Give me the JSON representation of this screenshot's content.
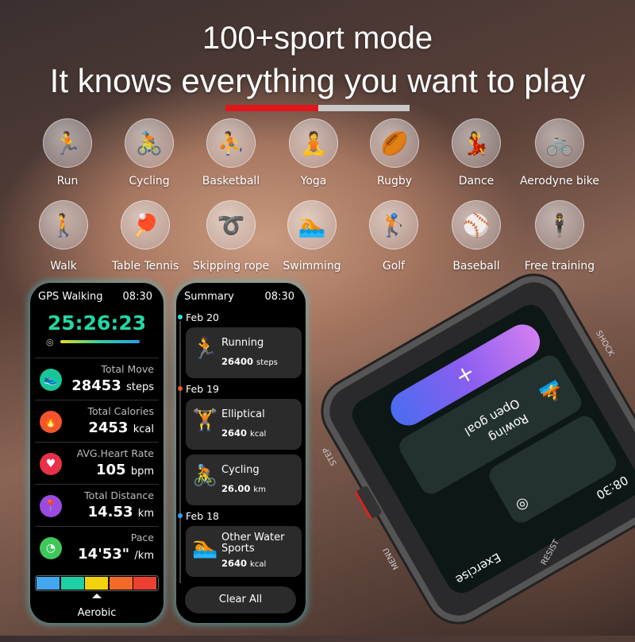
{
  "headline": {
    "line1": "100+sport mode",
    "line2": "It knows everything you want to play",
    "accent": "#e0161b"
  },
  "sports": [
    {
      "label": "Run",
      "icon": "run-icon",
      "glyph": "🏃"
    },
    {
      "label": "Cycling",
      "icon": "cycling-icon",
      "glyph": "🚴"
    },
    {
      "label": "Basketball",
      "icon": "basketball-icon",
      "glyph": "⛹"
    },
    {
      "label": "Yoga",
      "icon": "yoga-icon",
      "glyph": "🧘"
    },
    {
      "label": "Rugby",
      "icon": "rugby-icon",
      "glyph": "🏉"
    },
    {
      "label": "Dance",
      "icon": "dance-icon",
      "glyph": "💃"
    },
    {
      "label": "Aerodyne bike",
      "icon": "exercise-bike-icon",
      "glyph": "🚲"
    },
    {
      "label": "Walk",
      "icon": "walk-icon",
      "glyph": "🚶"
    },
    {
      "label": "Table Tennis",
      "icon": "table-tennis-icon",
      "glyph": "🏓"
    },
    {
      "label": "Skipping rope",
      "icon": "skipping-rope-icon",
      "glyph": "➰"
    },
    {
      "label": "Swimming",
      "icon": "swimming-icon",
      "glyph": "🏊"
    },
    {
      "label": "Golf",
      "icon": "golf-icon",
      "glyph": "🏌"
    },
    {
      "label": "Baseball",
      "icon": "baseball-icon",
      "glyph": "⚾"
    },
    {
      "label": "Free training",
      "icon": "free-training-icon",
      "glyph": "🕴"
    }
  ],
  "workout": {
    "title": "GPS Walking",
    "time": "08:30",
    "elapsed": "25:26:23",
    "zone": "Aerobic",
    "stats": [
      {
        "label": "Total Move",
        "value": "28453",
        "unit": "steps",
        "icon": "shoe-icon",
        "glyph": "👟",
        "color": "#17c79a"
      },
      {
        "label": "Total Calories",
        "value": "2453",
        "unit": "kcal",
        "icon": "flame-icon",
        "glyph": "🔥",
        "color": "#f2542d"
      },
      {
        "label": "AVG.Heart Rate",
        "value": "105",
        "unit": "bpm",
        "icon": "heart-icon",
        "glyph": "♥",
        "color": "#e8304a"
      },
      {
        "label": "Total Distance",
        "value": "14.53",
        "unit": "km",
        "icon": "location-icon",
        "glyph": "📍",
        "color": "#9b4be0"
      },
      {
        "label": "Pace",
        "value": "14'53\"",
        "unit": "/km",
        "icon": "speedometer-icon",
        "glyph": "◔",
        "color": "#3fc85a"
      }
    ],
    "zone_colors": [
      "#45a6f0",
      "#1fcfa5",
      "#f2d20f",
      "#f26a2a",
      "#ee3f33"
    ]
  },
  "summary": {
    "title": "Summary",
    "time": "08:30",
    "clear": "Clear All",
    "dates": [
      {
        "label": "Feb 20",
        "color": "#2fe0d8"
      },
      {
        "label": "Feb 19",
        "color": "#f2542d"
      },
      {
        "label": "Feb 18",
        "color": "#3a9df0"
      }
    ],
    "items": [
      {
        "name": "Running",
        "value": "26400",
        "unit": "steps",
        "glyph": "🏃"
      },
      {
        "name": "Elliptical",
        "value": "2640",
        "unit": "kcal",
        "glyph": "🏋"
      },
      {
        "name": "Cycling",
        "value": "26.00",
        "unit": "km",
        "glyph": "🚴"
      },
      {
        "name": "Other Water Sports",
        "value": "2640",
        "unit": "kcal",
        "glyph": "🏊"
      }
    ]
  },
  "watch": {
    "buttons": [
      "STEP",
      "MENU",
      "SHOCK",
      "RESIST"
    ],
    "card1": "Rowing",
    "card1_sub": "Open goal",
    "time": "08:30",
    "footer": "Exercise",
    "add": "+"
  }
}
